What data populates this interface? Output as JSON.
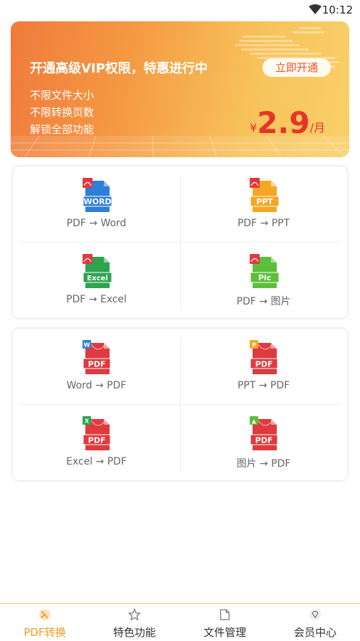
{
  "status_bar": {
    "time": "10:12"
  },
  "banner": {
    "title": "开通高级VIP权限，特惠进行中",
    "cta_label": "立即开通",
    "features": [
      "不限文件大小",
      "不限转换页数",
      "解锁全部功能"
    ],
    "price_currency": "¥",
    "price_value": "2.9",
    "price_unit": "/月"
  },
  "from_pdf": [
    {
      "label": "PDF → Word",
      "icon": "pdf-to-word-icon",
      "badge": "WORD",
      "color": "#2f7fd8"
    },
    {
      "label": "PDF → PPT",
      "icon": "pdf-to-ppt-icon",
      "badge": "PPT",
      "color": "#f5a623"
    },
    {
      "label": "PDF → Excel",
      "icon": "pdf-to-excel-icon",
      "badge": "Excel",
      "color": "#2ea44f"
    },
    {
      "label": "PDF → 图片",
      "icon": "pdf-to-image-icon",
      "badge": "Pic",
      "color": "#5cbf3a"
    }
  ],
  "to_pdf": [
    {
      "label": "Word → PDF",
      "icon": "word-to-pdf-icon",
      "mini": "W",
      "mini_color": "#2f7fd8"
    },
    {
      "label": "PPT → PDF",
      "icon": "ppt-to-pdf-icon",
      "mini": "P",
      "mini_color": "#f5a623"
    },
    {
      "label": "Excel → PDF",
      "icon": "excel-to-pdf-icon",
      "mini": "X",
      "mini_color": "#2ea44f"
    },
    {
      "label": "图片 → PDF",
      "icon": "image-to-pdf-icon",
      "mini": "▲",
      "mini_color": "#5cbf3a"
    }
  ],
  "pdf_badge": "PDF",
  "tabs": [
    {
      "label": "PDF转换",
      "icon": "pdf-convert-icon",
      "active": true
    },
    {
      "label": "特色功能",
      "icon": "star-icon",
      "active": false
    },
    {
      "label": "文件管理",
      "icon": "folder-icon",
      "active": false
    },
    {
      "label": "会员中心",
      "icon": "diamond-icon",
      "active": false
    }
  ],
  "colors": {
    "accent": "#f39a1e",
    "price": "#e53528",
    "pdf_red": "#e0393e"
  }
}
